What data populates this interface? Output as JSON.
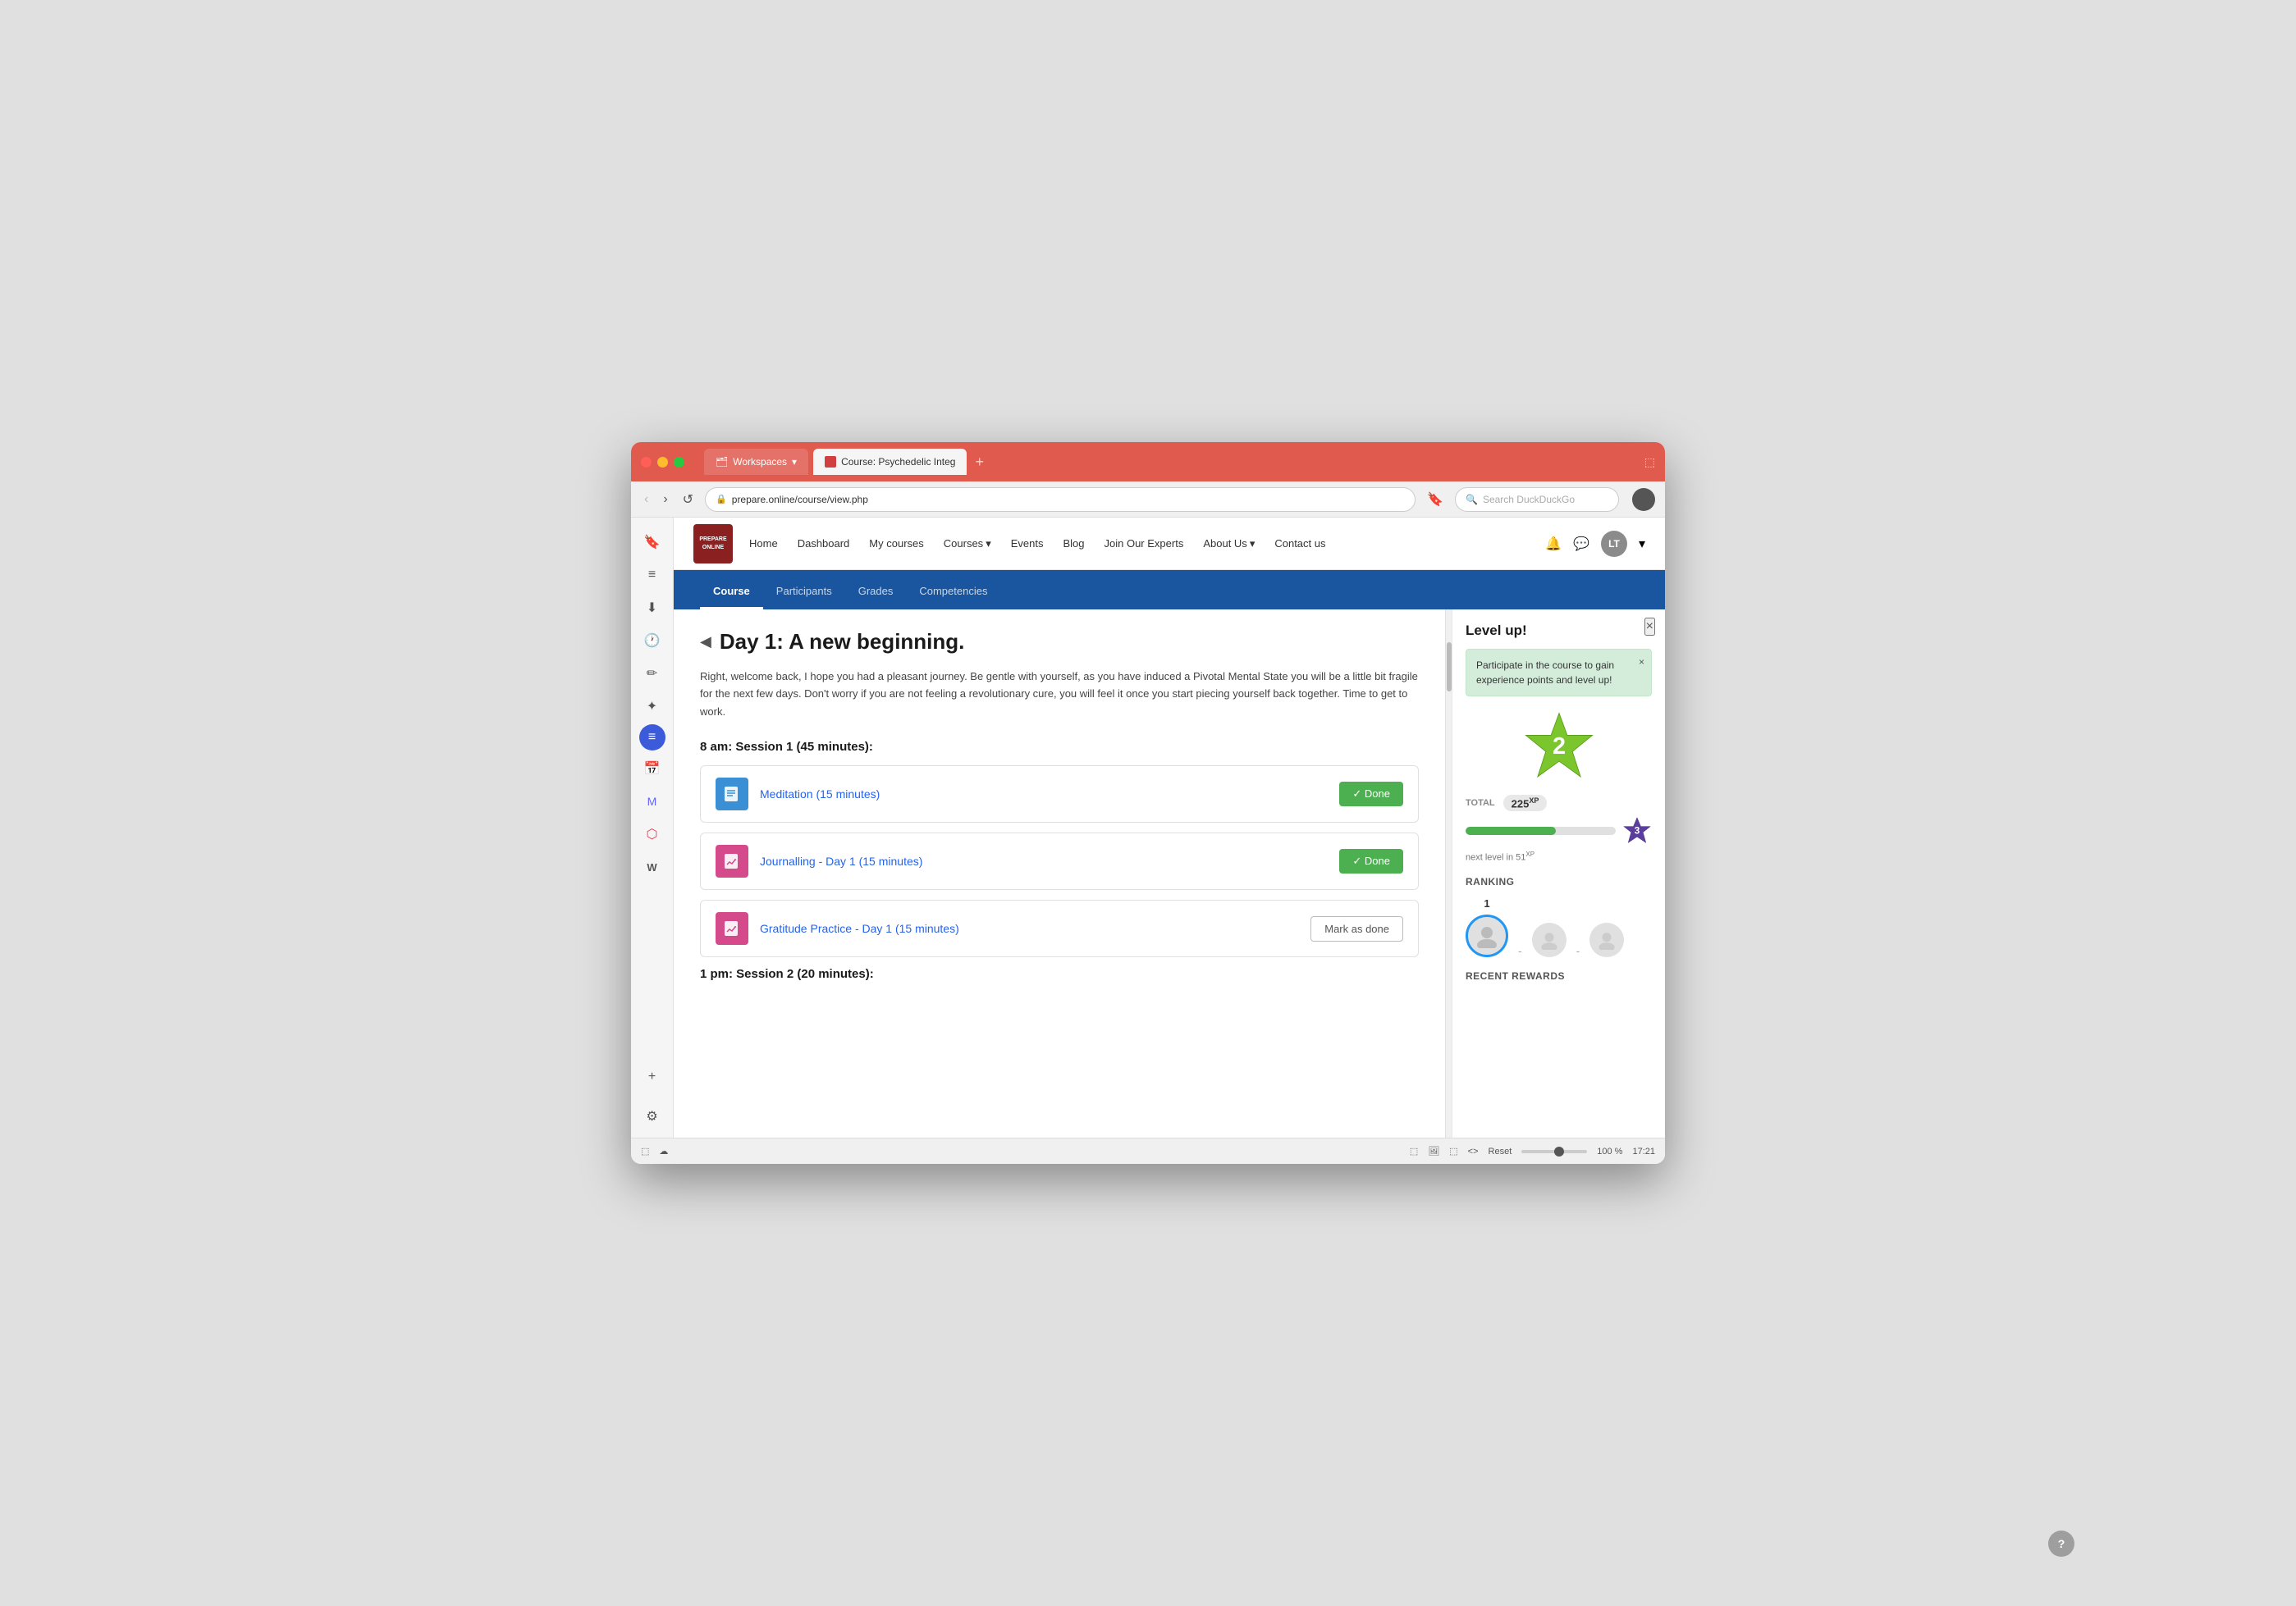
{
  "browser": {
    "titlebar": {
      "workspaces_label": "Workspaces",
      "tab_label": "Course: Psychedelic Integ",
      "new_tab_label": "+"
    },
    "addressbar": {
      "url": "prepare.online/course/view.php",
      "search_placeholder": "Search DuckDuckGo"
    }
  },
  "site_header": {
    "logo_text": "PREPARE ONLINE",
    "nav_links": [
      "Home",
      "Dashboard",
      "My courses",
      "Courses",
      "Events",
      "Blog",
      "Join Our Experts",
      "About Us",
      "Contact us"
    ],
    "user_initials": "LT"
  },
  "course_nav": {
    "tabs": [
      "Course",
      "Participants",
      "Grades",
      "Competencies"
    ],
    "active_tab": "Course"
  },
  "course": {
    "day_title": "Day 1: A new beginning.",
    "collapse_icon": "◀",
    "description": "Right, welcome back, I hope you had a pleasant journey. Be gentle with yourself, as you have induced a Pivotal Mental State you will be a little bit fragile for the next few days. Don't worry if you are not feeling a revolutionary cure, you will feel it once you start piecing yourself back together. Time to get to work.",
    "session1_title": "8 am: Session 1 (45 minutes):",
    "activities": [
      {
        "name": "Meditation (15 minutes)",
        "icon_type": "blue",
        "icon_symbol": "📄",
        "status": "done",
        "done_label": "✓ Done"
      },
      {
        "name": "Journalling - Day 1 (15 minutes)",
        "icon_type": "pink",
        "icon_symbol": "📥",
        "status": "done",
        "done_label": "✓ Done"
      },
      {
        "name": "Gratitude Practice - Day 1 (15 minutes)",
        "icon_type": "pink",
        "icon_symbol": "📥",
        "status": "pending",
        "mark_done_label": "Mark as done"
      }
    ],
    "session2_title": "1 pm: Session 2 (20 minutes):"
  },
  "level_sidebar": {
    "title": "Level up!",
    "close_label": "×",
    "message": "Participate in the course to gain experience points and level up!",
    "message_close": "×",
    "current_level": "2",
    "total_label": "TOTAL",
    "total_xp": "225",
    "xp_suffix": "XP",
    "next_level_text": "next level in 51",
    "next_level_xp": "XP",
    "next_level_number": "3",
    "progress_percent": 60,
    "ranking_title": "RANKING",
    "rank_1_label": "1",
    "rank_2_label": "-",
    "rank_3_label": "-",
    "recent_rewards_title": "RECENT REWARDS"
  },
  "help_btn": "?",
  "status_bar": {
    "left_icons": [
      "⬚",
      "☁"
    ],
    "right_icons": [
      "⬚",
      "🖼",
      "⬚",
      "<>"
    ],
    "reset_label": "Reset",
    "zoom_label": "100 %",
    "time": "17:21"
  }
}
